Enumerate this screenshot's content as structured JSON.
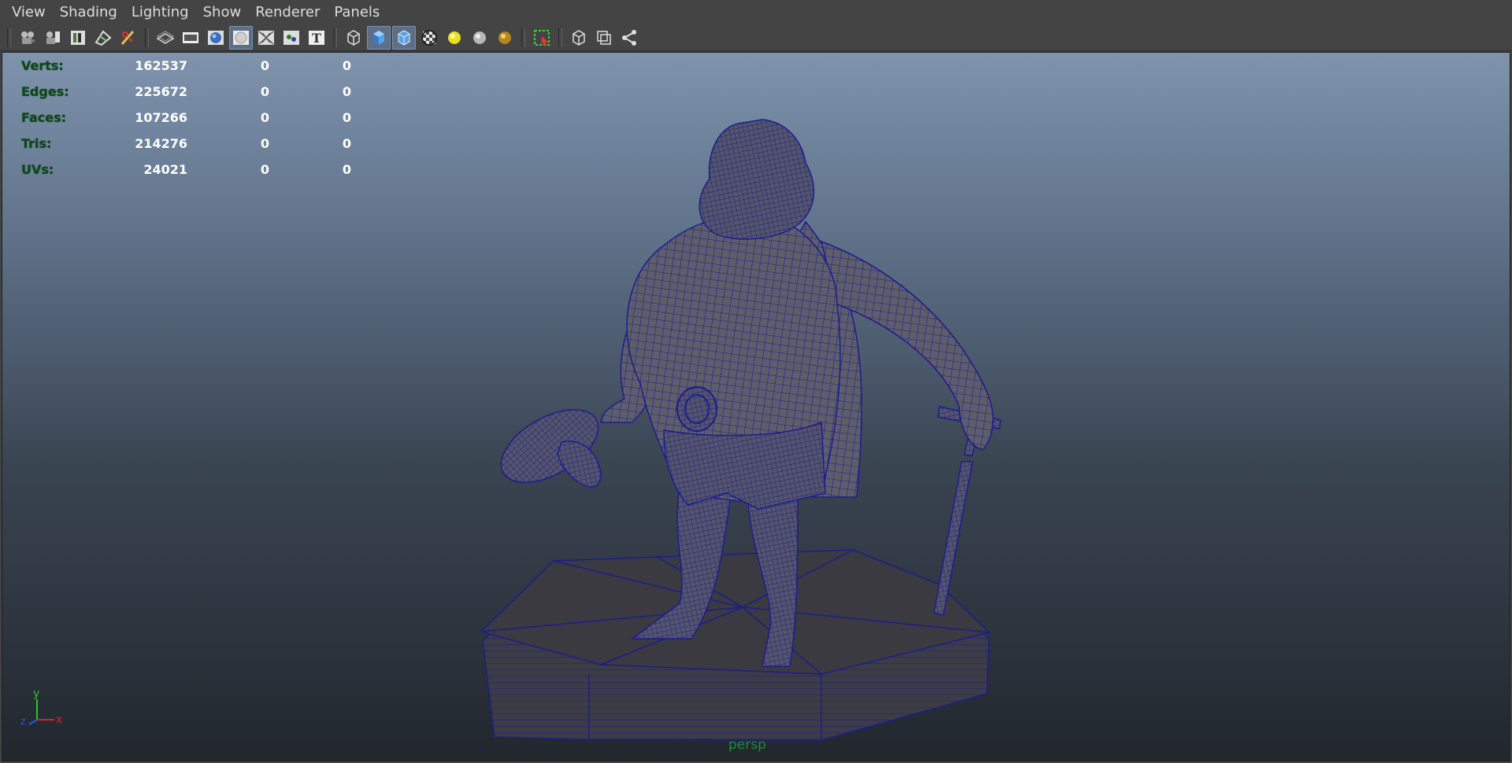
{
  "menu": [
    "View",
    "Shading",
    "Lighting",
    "Show",
    "Renderer",
    "Panels"
  ],
  "toolbar": {
    "groups": [
      [
        "camera-attributes-icon",
        "camera-bookmarks-icon",
        "image-plane-icon",
        "2d-pan-zoom-icon",
        "grease-pencil-icon"
      ],
      [
        "grid-icon",
        "film-gate-icon",
        "resolution-gate-icon",
        "gate-mask-icon",
        "field-chart-icon",
        "safe-action-icon",
        "safe-title-icon"
      ],
      [
        "wireframe-icon",
        "smooth-shade-icon",
        "wireframe-on-shaded-icon",
        "textured-icon",
        "use-all-lights-icon",
        "shadows-icon",
        "screen-space-ambient-occlusion-icon"
      ],
      [
        "isolate-select-icon"
      ],
      [
        "xray-icon",
        "xray-joints-icon",
        "xray-active-icon"
      ]
    ],
    "active": [
      "smooth-shade-icon",
      "wireframe-on-shaded-icon"
    ]
  },
  "hud": {
    "rows": [
      {
        "label": "Verts:",
        "v1": "162537",
        "v2": "0",
        "v3": "0"
      },
      {
        "label": "Edges:",
        "v1": "225672",
        "v2": "0",
        "v3": "0"
      },
      {
        "label": "Faces:",
        "v1": "107266",
        "v2": "0",
        "v3": "0"
      },
      {
        "label": "Tris:",
        "v1": "214276",
        "v2": "0",
        "v3": "0"
      },
      {
        "label": "UVs:",
        "v1": "24021",
        "v2": "0",
        "v3": "0"
      }
    ]
  },
  "axis": {
    "y": "y",
    "x": "x",
    "z": "z"
  },
  "camera_name": "persp",
  "colors": {
    "wire": "#1a1a8c",
    "mesh_fill": "#5a5a66",
    "hud_label": "#0c4a1a",
    "cam_label": "#1f8a3a"
  }
}
